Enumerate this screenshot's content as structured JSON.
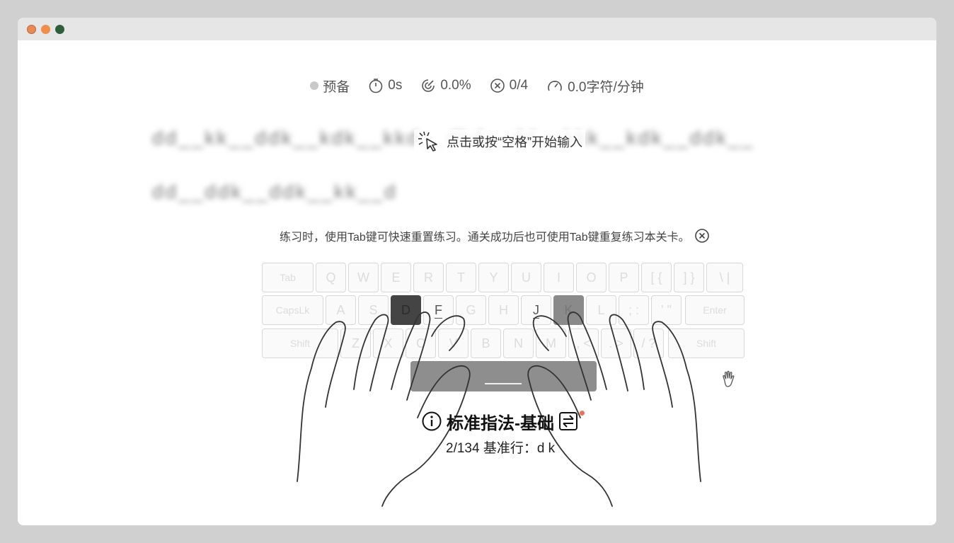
{
  "window": {
    "traffic_lights": [
      "close",
      "minimize",
      "maximize"
    ]
  },
  "stats": {
    "status": "预备",
    "time": "0s",
    "accuracy": "0.0%",
    "errors": "0/4",
    "speed": "0.0字符/分钟"
  },
  "practice": {
    "line1": "dd__kk__ddk__kdk__kkd__dkd__dd__kkk__kdk__ddk__",
    "line2": "dd__ddk__ddk__kk__d",
    "start_hint": "点击或按“空格”开始输入"
  },
  "tip": {
    "text": "练习时，使用Tab键可快速重置练习。通关成功后也可使用Tab键重复练习本关卡。"
  },
  "keyboard": {
    "row1": [
      "Tab",
      "Q",
      "W",
      "E",
      "R",
      "T",
      "Y",
      "U",
      "I",
      "O",
      "P",
      "[ {",
      "] }",
      "\\ |"
    ],
    "row2": [
      "CapsLk",
      "A",
      "S",
      "D",
      "F",
      "G",
      "H",
      "J",
      "K",
      "L",
      "; :",
      "' \"",
      "Enter"
    ],
    "row3": [
      "Shift",
      "Z",
      "X",
      "C",
      "V",
      "B",
      "N",
      "M",
      ", <",
      ". >",
      "/ ?",
      "Shift"
    ],
    "active_keys": [
      "D",
      "K"
    ],
    "home_keys": [
      "F",
      "J"
    ]
  },
  "lesson": {
    "title": "标准指法-基础",
    "subtitle": "2/134 基准行：d k"
  },
  "colors": {
    "background": "#d0d0d0",
    "window": "#ffffff",
    "titlebar": "#e6e6e6",
    "key_active": "#444444",
    "space_bar": "#8e8e8e"
  },
  "icons": {
    "timer": "timer-icon",
    "accuracy": "target-icon",
    "errors": "x-circle-icon",
    "speed": "gauge-icon",
    "click": "click-icon",
    "close_tip": "close-circle-icon",
    "info": "info-icon",
    "switch": "switch-icon",
    "hand": "hand-icon"
  }
}
